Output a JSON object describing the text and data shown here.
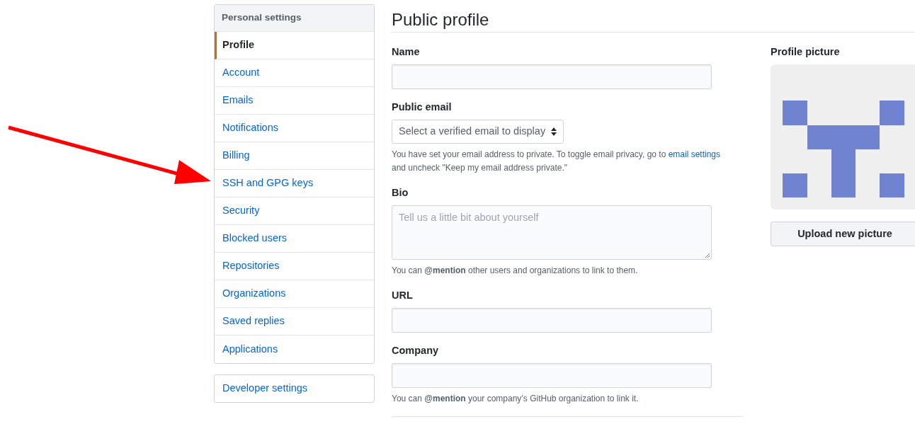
{
  "sidebar": {
    "header": "Personal settings",
    "items": [
      {
        "label": "Profile",
        "selected": true
      },
      {
        "label": "Account",
        "selected": false
      },
      {
        "label": "Emails",
        "selected": false
      },
      {
        "label": "Notifications",
        "selected": false
      },
      {
        "label": "Billing",
        "selected": false
      },
      {
        "label": "SSH and GPG keys",
        "selected": false
      },
      {
        "label": "Security",
        "selected": false
      },
      {
        "label": "Blocked users",
        "selected": false
      },
      {
        "label": "Repositories",
        "selected": false
      },
      {
        "label": "Organizations",
        "selected": false
      },
      {
        "label": "Saved replies",
        "selected": false
      },
      {
        "label": "Applications",
        "selected": false
      }
    ],
    "developer_link": "Developer settings"
  },
  "title": "Public profile",
  "fields": [
    {
      "kind": "text",
      "label": "Name"
    },
    {
      "kind": "select",
      "label": "Public email",
      "placeholder": "Select a verified email to display",
      "hint": [
        {
          "kind": "text",
          "text": "You have set your email address to private. To toggle email privacy, go to "
        },
        {
          "kind": "link",
          "text": "email settings"
        },
        {
          "kind": "text",
          "text": " and uncheck \"Keep my email address private.\""
        }
      ]
    },
    {
      "kind": "textarea",
      "label": "Bio",
      "placeholder": "Tell us a little bit about yourself",
      "hint": [
        {
          "kind": "text",
          "text": "You can **@mention** other users and organizations to link to them."
        }
      ]
    },
    {
      "kind": "text",
      "label": "URL"
    },
    {
      "kind": "text",
      "label": "Company",
      "hint": [
        {
          "kind": "text",
          "text": "You can **@mention** your company’s GitHub organization to link it."
        }
      ]
    }
  ],
  "profile_picture": {
    "label": "Profile picture",
    "button": "Upload new picture"
  }
}
